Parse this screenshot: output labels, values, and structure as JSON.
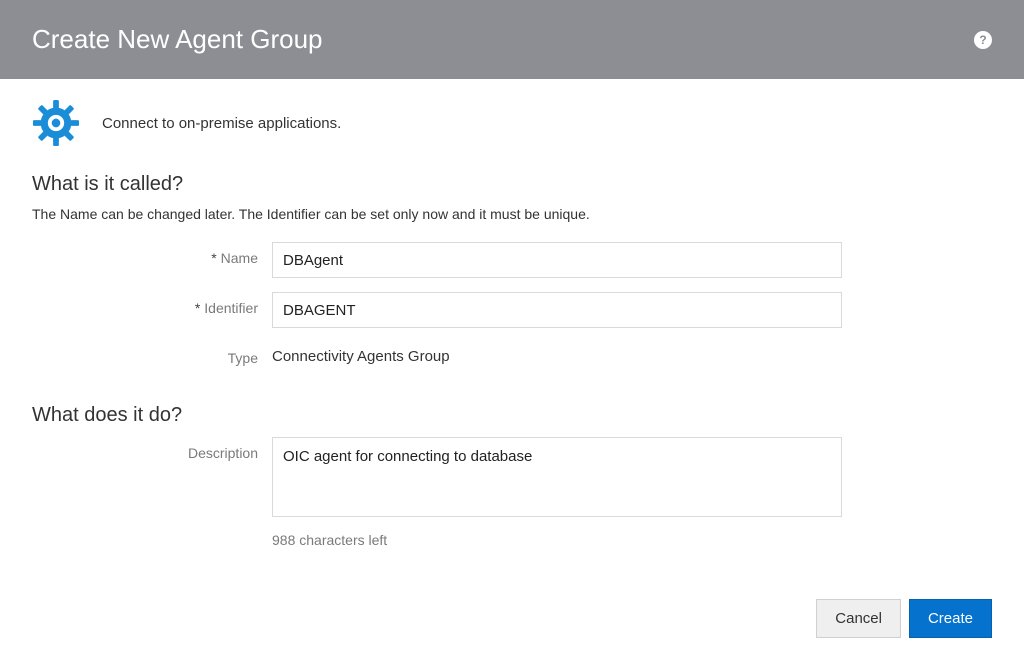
{
  "header": {
    "title": "Create New Agent Group",
    "help_tooltip": "?"
  },
  "intro": {
    "text": "Connect to on-premise applications."
  },
  "section_called": {
    "title": "What is it called?",
    "subtitle": "The Name can be changed later. The Identifier can be set only now and it must be unique.",
    "name_label": "Name",
    "name_value": "DBAgent",
    "identifier_label": "Identifier",
    "identifier_value": "DBAGENT",
    "type_label": "Type",
    "type_value": "Connectivity Agents Group"
  },
  "section_do": {
    "title": "What does it do?",
    "description_label": "Description",
    "description_value": "OIC agent for connecting to database",
    "chars_left": "988 characters left"
  },
  "buttons": {
    "cancel": "Cancel",
    "create": "Create"
  }
}
